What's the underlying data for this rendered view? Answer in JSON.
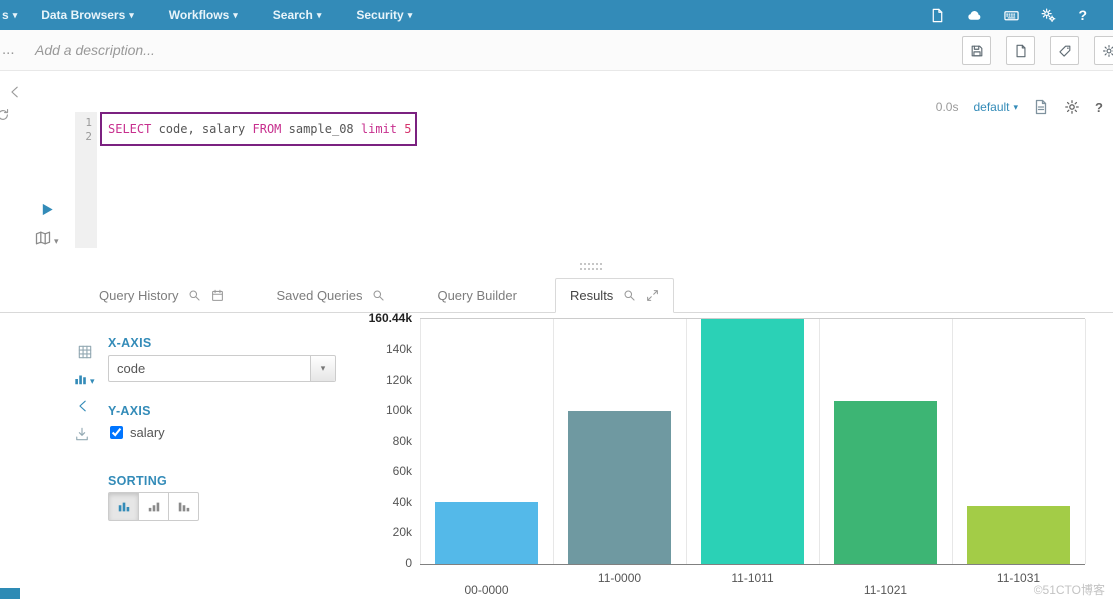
{
  "glyphs": {
    "caret_down": "▾"
  },
  "navbar": {
    "partial_item": "s",
    "items": [
      {
        "label": "Data Browsers"
      },
      {
        "label": "Workflows"
      },
      {
        "label": "Search"
      },
      {
        "label": "Security"
      }
    ],
    "help_label": "?"
  },
  "toolbar": {
    "truncated_title": "...",
    "description_placeholder": "Add a description..."
  },
  "editor": {
    "line_numbers": [
      "1",
      "2"
    ],
    "query": {
      "text": "SELECT code, salary FROM sample_08 limit 5",
      "tokens": [
        {
          "text": "SELECT ",
          "type": "keyword"
        },
        {
          "text": "code, salary ",
          "type": "identifier"
        },
        {
          "text": "FROM ",
          "type": "keyword"
        },
        {
          "text": "sample_08 ",
          "type": "identifier"
        },
        {
          "text": "limit ",
          "type": "keyword"
        },
        {
          "text": "5",
          "type": "number"
        }
      ]
    },
    "status": {
      "duration": "0.0s",
      "database": "default",
      "help_label": "?"
    }
  },
  "tabs": [
    {
      "label": "Query History",
      "active": false
    },
    {
      "label": "Saved Queries",
      "active": false
    },
    {
      "label": "Query Builder",
      "active": false
    },
    {
      "label": "Results",
      "active": true
    }
  ],
  "chart_settings": {
    "x_axis_heading": "X-AXIS",
    "x_axis_selected": "code",
    "y_axis_heading": "Y-AXIS",
    "y_axis_series": [
      {
        "name": "salary",
        "checked": true
      }
    ],
    "sorting_heading": "SORTING",
    "sorting_options": [
      "none",
      "ascending",
      "descending"
    ],
    "sorting_active_index": 0
  },
  "chart_data": {
    "type": "bar",
    "title": "",
    "categories": [
      "00-0000",
      "11-0000",
      "11-1011",
      "11-1021",
      "11-1031"
    ],
    "values": [
      40500,
      100500,
      160440,
      107000,
      37800
    ],
    "series_name": "salary",
    "xlabel": "code",
    "ylabel": "salary",
    "ylim": [
      0,
      160440
    ],
    "yticks": [
      {
        "value": 0,
        "label": "0"
      },
      {
        "value": 20000,
        "label": "20k"
      },
      {
        "value": 40000,
        "label": "40k"
      },
      {
        "value": 60000,
        "label": "60k"
      },
      {
        "value": 80000,
        "label": "80k"
      },
      {
        "value": 100000,
        "label": "100k"
      },
      {
        "value": 120000,
        "label": "120k"
      },
      {
        "value": 140000,
        "label": "140k"
      },
      {
        "value": 160440,
        "label": "160.44k",
        "bold": true
      }
    ],
    "bar_colors": [
      "#54b9e9",
      "#6f99a1",
      "#2bd1b6",
      "#3db574",
      "#a3cc47"
    ],
    "grid": "vertical",
    "legend": "none",
    "bar_width_ratio": 0.78,
    "x_label_offsets": [
      14,
      2,
      2,
      14,
      2
    ]
  },
  "watermark": "©51CTO博客",
  "colors": {
    "navbar_bg": "#338bb8",
    "accent": "#338bb8",
    "keyword": "#c72f8e",
    "selection_box": "#7b2180"
  }
}
